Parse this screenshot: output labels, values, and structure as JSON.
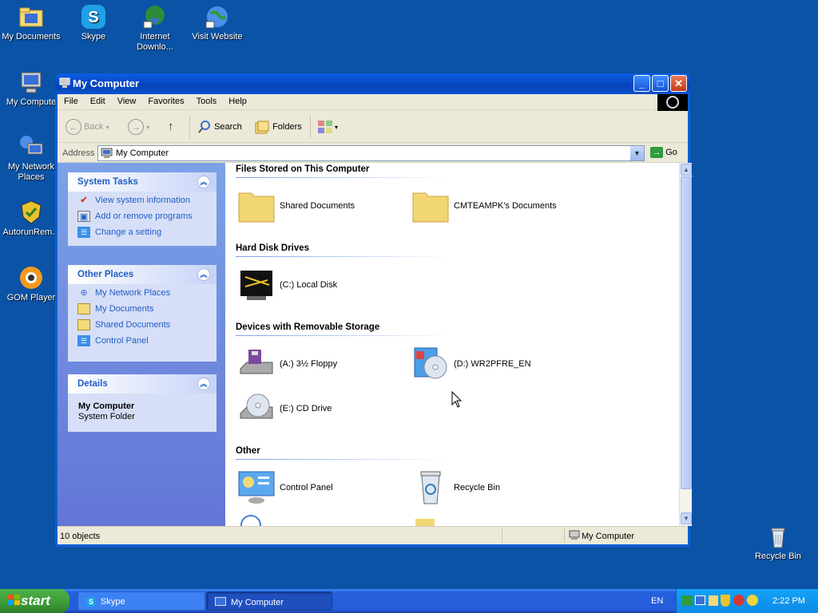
{
  "desktop": {
    "icons": [
      {
        "label": "My Documents"
      },
      {
        "label": "Skype"
      },
      {
        "label": "Internet Downlo..."
      },
      {
        "label": "Visit Website"
      },
      {
        "label": "My Compute"
      },
      {
        "label": "My Network Places"
      },
      {
        "label": "AutorunRem..."
      },
      {
        "label": "GOM Player"
      },
      {
        "label": "Recycle Bin"
      }
    ]
  },
  "window": {
    "title": "My Computer",
    "menu": [
      "File",
      "Edit",
      "View",
      "Favorites",
      "Tools",
      "Help"
    ],
    "toolbar": {
      "back": "Back",
      "search": "Search",
      "folders": "Folders"
    },
    "address": {
      "label": "Address",
      "value": "My Computer",
      "go": "Go"
    },
    "tasks": {
      "system": {
        "title": "System Tasks",
        "items": [
          "View system information",
          "Add or remove programs",
          "Change a setting"
        ]
      },
      "other": {
        "title": "Other Places",
        "items": [
          "My Network Places",
          "My Documents",
          "Shared Documents",
          "Control Panel"
        ]
      },
      "details": {
        "title": "Details",
        "name": "My Computer",
        "type": "System Folder"
      }
    },
    "sections": {
      "files": {
        "title": "Files Stored on This Computer",
        "items": [
          "Shared Documents",
          "CMTEAMPK's Documents"
        ]
      },
      "hdd": {
        "title": "Hard Disk Drives",
        "items": [
          "(C:) Local Disk"
        ]
      },
      "removable": {
        "title": "Devices with Removable Storage",
        "items": [
          "(A:) 3½ Floppy",
          "(D:) WR2PFRE_EN",
          "(E:) CD Drive"
        ]
      },
      "other": {
        "title": "Other",
        "items": [
          "Control Panel",
          "Recycle Bin"
        ]
      }
    },
    "status": {
      "count": "10 objects",
      "location": "My Computer"
    }
  },
  "taskbar": {
    "start": "start",
    "tasks": [
      "Skype",
      "My Computer"
    ],
    "lang": "EN",
    "clock": "2:22 PM"
  },
  "colors": {
    "desktop": "#0a53a6",
    "title_bar": "#0842b8",
    "task_link": "#215dc6",
    "start_button": "#3c9a37"
  }
}
